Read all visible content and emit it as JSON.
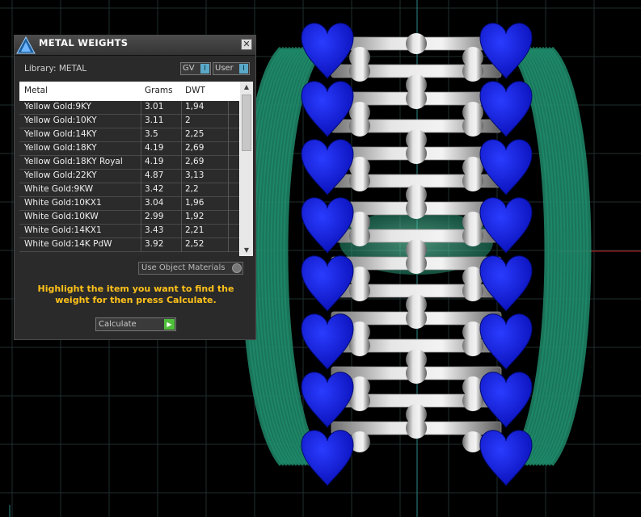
{
  "panel": {
    "title": "METAL WEIGHTS",
    "close_glyph": "✕",
    "logo_icon": "triangle-logo-icon",
    "library_label": "Library: METAL",
    "toggles": [
      {
        "label": "GV",
        "indicator": "I"
      },
      {
        "label": "User",
        "indicator": "I"
      }
    ],
    "table": {
      "headers": {
        "metal": "Metal",
        "grams": "Grams",
        "dwt": "DWT"
      },
      "rows": [
        {
          "metal": "Yellow Gold:9KY",
          "grams": "3.01",
          "dwt": "1,94"
        },
        {
          "metal": "Yellow Gold:10KY",
          "grams": "3.11",
          "dwt": "2"
        },
        {
          "metal": "Yellow Gold:14KY",
          "grams": "3.5",
          "dwt": "2,25"
        },
        {
          "metal": "Yellow Gold:18KY",
          "grams": "4.19",
          "dwt": "2,69"
        },
        {
          "metal": "Yellow Gold:18KY Royal",
          "grams": "4.19",
          "dwt": "2,69"
        },
        {
          "metal": "Yellow Gold:22KY",
          "grams": "4.87",
          "dwt": "3,13"
        },
        {
          "metal": "White Gold:9KW",
          "grams": "3.42",
          "dwt": "2,2"
        },
        {
          "metal": "White Gold:10KX1",
          "grams": "3.04",
          "dwt": "1,96"
        },
        {
          "metal": "White Gold:10KW",
          "grams": "2.99",
          "dwt": "1,92"
        },
        {
          "metal": "White Gold:14KX1",
          "grams": "3.43",
          "dwt": "2,21"
        },
        {
          "metal": "White Gold:14K PdW",
          "grams": "3.92",
          "dwt": "2,52"
        }
      ]
    },
    "use_object_materials": "Use Object Materials",
    "hint": "Highlight the item you want to find the weight for then press Calculate.",
    "calculate_label": "Calculate"
  },
  "colors": {
    "background": "#000000",
    "grid": "#1f2e2e",
    "hearts": "#1020e0",
    "bands": "#1f8a6a",
    "links": "#b8b8b8",
    "accent_text": "#ffc21a"
  }
}
